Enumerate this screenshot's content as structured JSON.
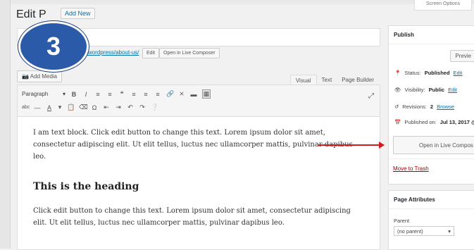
{
  "header": {
    "title": "Edit P",
    "add_new": "Add New",
    "screen_options": "Screen Options"
  },
  "badge": {
    "number": "3"
  },
  "permalink": {
    "url": ".1/wordpress/about-us/",
    "edit_label": "Edit",
    "live_composer_label": "Open in Live Composer"
  },
  "editor": {
    "add_media": "Add Media",
    "tabs": [
      "Visual",
      "Text",
      "Page Builder"
    ],
    "format_select": "Paragraph",
    "content": {
      "paragraph1": "I am text block. Click edit button to change this text. Lorem ipsum dolor sit amet, consectetur adipiscing elit. Ut elit tellus, luctus nec ullamcorper mattis, pulvinar dapibus leo.",
      "heading": "This is the heading",
      "paragraph2": "Click edit button to change this text. Lorem ipsum dolor sit amet, consectetur adipiscing elit. Ut elit tellus, luctus nec ullamcorper mattis, pulvinar dapibus leo."
    }
  },
  "publish": {
    "title": "Publish",
    "preview": "Previe",
    "status_label": "Status:",
    "status_value": "Published",
    "status_edit": "Edit",
    "visibility_label": "Visibility:",
    "visibility_value": "Public",
    "visibility_edit": "Edit",
    "revisions_label": "Revisions:",
    "revisions_value": "2",
    "revisions_browse": "Browse",
    "published_on_label": "Published on:",
    "published_on_value": "Jul 13, 2017 @",
    "live_composer_button": "Open in Live Compos",
    "move_to_trash": "Move to Trash"
  },
  "page_attributes": {
    "title": "Page Attributes",
    "parent_label": "Parent",
    "parent_value": "(no parent)"
  },
  "colors": {
    "badge": "#2b5aa8",
    "arrow": "#d01c1c",
    "link": "#0073aa"
  }
}
